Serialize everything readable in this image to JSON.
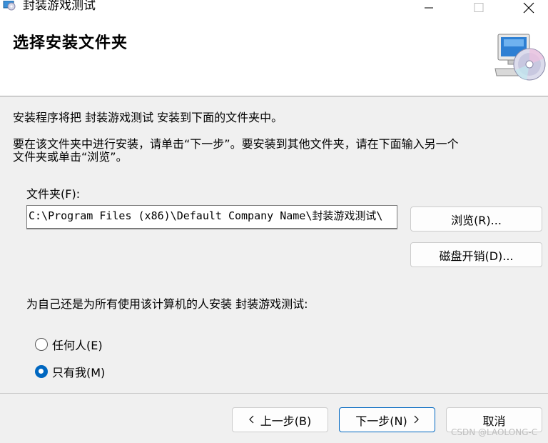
{
  "window": {
    "title": "封装游戏测试"
  },
  "header": {
    "title": "选择安装文件夹"
  },
  "body": {
    "line1": "安装程序将把 封装游戏测试 安装到下面的文件夹中。",
    "line2a": "要在该文件夹中进行安装，请单击“下一步”。要安装到其他文件夹，请在下面输入另一个",
    "line2b": "文件夹或单击“浏览”。"
  },
  "folder": {
    "label": "文件夹(F):",
    "value": "C:\\Program Files (x86)\\Default Company Name\\封装游戏测试\\"
  },
  "buttons": {
    "browse": "浏览(R)...",
    "disk_cost": "磁盘开销(D)...",
    "back": "上一步(B)",
    "next": "下一步(N)",
    "cancel": "取消"
  },
  "install_for": {
    "question": "为自己还是为所有使用该计算机的人安装 封装游戏测试:",
    "options": [
      {
        "label": "任何人(E)",
        "checked": false
      },
      {
        "label": "只有我(M)",
        "checked": true
      }
    ]
  },
  "watermark": "CSDN @LAOLONG-C",
  "colors": {
    "accent": "#0067c0"
  }
}
